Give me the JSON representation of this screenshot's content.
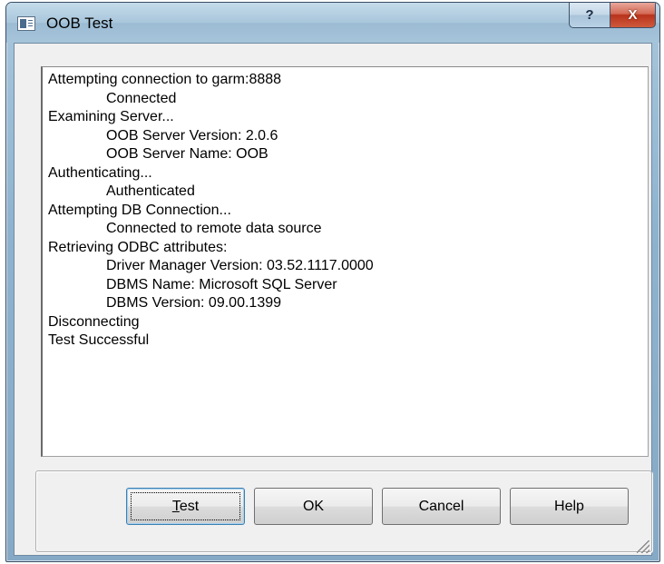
{
  "window": {
    "title": "OOB Test",
    "help_label": "?",
    "close_label": "X"
  },
  "log": {
    "lines": [
      {
        "text": "Attempting connection to garm:8888",
        "indent": false
      },
      {
        "text": "Connected",
        "indent": true
      },
      {
        "text": "Examining Server...",
        "indent": false
      },
      {
        "text": "OOB Server Version: 2.0.6",
        "indent": true
      },
      {
        "text": "OOB Server Name: OOB",
        "indent": true
      },
      {
        "text": "Authenticating...",
        "indent": false
      },
      {
        "text": "Authenticated",
        "indent": true
      },
      {
        "text": "Attempting DB Connection...",
        "indent": false
      },
      {
        "text": "Connected to remote data source",
        "indent": true
      },
      {
        "text": "Retrieving ODBC attributes:",
        "indent": false
      },
      {
        "text": "Driver Manager Version: 03.52.1117.0000",
        "indent": true
      },
      {
        "text": "DBMS Name: Microsoft SQL Server",
        "indent": true
      },
      {
        "text": "DBMS Version: 09.00.1399",
        "indent": true
      },
      {
        "text": "Disconnecting",
        "indent": false
      },
      {
        "text": "Test Successful",
        "indent": false
      }
    ]
  },
  "buttons": {
    "test": "Test",
    "ok": "OK",
    "cancel": "Cancel",
    "help": "Help"
  }
}
